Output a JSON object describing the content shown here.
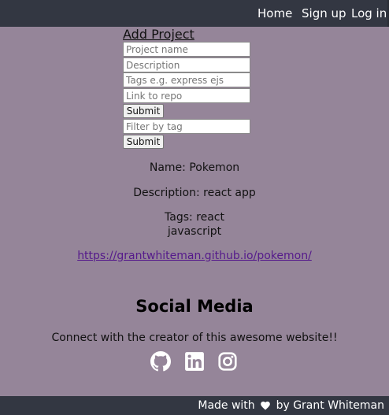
{
  "nav": {
    "home": "Home",
    "signup": "Sign up",
    "login": "Log in"
  },
  "form": {
    "title": "Add Project",
    "name_placeholder": "Project name",
    "description_placeholder": "Description",
    "tags_placeholder": "Tags e.g. express ejs",
    "repo_placeholder": "Link to repo",
    "submit_label": "Submit",
    "filter_placeholder": "Filter by tag",
    "filter_submit_label": "Submit"
  },
  "project": {
    "name_line": "Name: Pokemon",
    "description_line": "Description: react app",
    "tags_line": "Tags: react",
    "tags_extra": "javascript",
    "repo_url": "https://grantwhiteman.github.io/pokemon/"
  },
  "social": {
    "title": "Social Media",
    "tagline": "Connect with the creator of this awesome website!!",
    "icons": [
      "github-icon",
      "linkedin-icon",
      "instagram-icon"
    ]
  },
  "footer": {
    "made_with": "Made with",
    "by": "by Grant Whiteman",
    "heart_icon": "heart-icon"
  },
  "colors": {
    "page_bg": "#958599",
    "nav_bg": "#333742",
    "link_visited": "#551a8b"
  }
}
